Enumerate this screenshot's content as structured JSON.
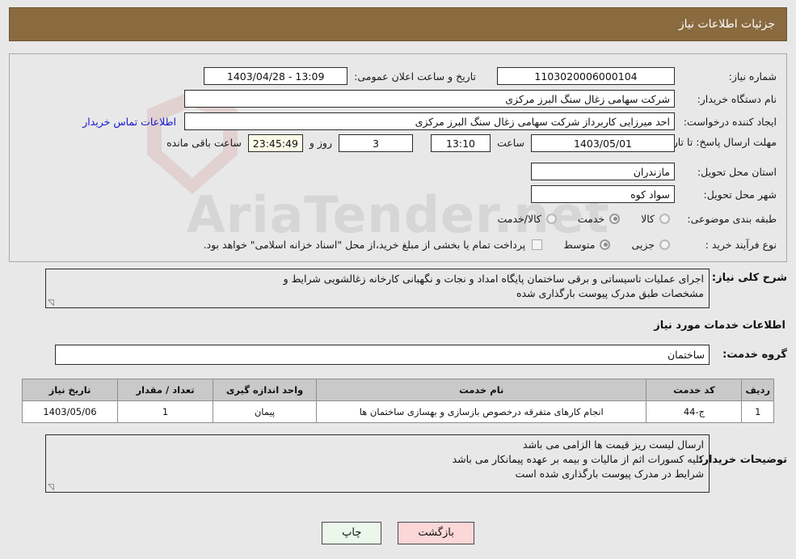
{
  "header": {
    "title": "جزئیات اطلاعات نیاز"
  },
  "form": {
    "need_number_label": "شماره نیاز:",
    "need_number_value": "1103020006000104",
    "announce_label": "تاریخ و ساعت اعلان عمومی:",
    "announce_value": "1403/04/28 - 13:09",
    "buyer_org_label": "نام دستگاه خریدار:",
    "buyer_org_value": "شرکت سهامی زغال سنگ البرز مرکزی",
    "creator_label": "ایجاد کننده درخواست:",
    "creator_value": "احد میرزایی کاربرداز شرکت سهامی زغال سنگ البرز مرکزی",
    "contact_link": "اطلاعات تماس خریدار",
    "deadline_label": "مهلت ارسال پاسخ: تا تاریخ:",
    "deadline_date": "1403/05/01",
    "hour_label": "ساعت",
    "deadline_time": "13:10",
    "days_value": "3",
    "days_label": "روز و",
    "remaining_time": "23:45:49",
    "remaining_label": "ساعت باقی مانده",
    "province_label": "استان محل تحویل:",
    "province_value": "مازندران",
    "city_label": "شهر محل تحویل:",
    "city_value": "سواد کوه",
    "category_label": "طبقه بندی موضوعی:",
    "category_options": [
      "کالا",
      "خدمت",
      "کالا/خدمت"
    ],
    "category_selected": "خدمت",
    "process_label": "نوع فرآیند خرید :",
    "process_options": [
      "جزیی",
      "متوسط"
    ],
    "process_selected": "متوسط",
    "treasury_checkbox_label": "پرداخت تمام یا بخشی از مبلغ خرید،از محل \"اسناد خزانه اسلامی\" خواهد بود.",
    "treasury_checked": false
  },
  "description": {
    "label": "شرح کلی نیاز:",
    "line1": "اجرای عملیات تاسیساتی و برقی ساختمان پایگاه امداد و نجات و نگهبانی کارخانه زغالشویی شرایط و",
    "line2": "مشخصات طبق مدرک پیوست بارگذاری شده"
  },
  "services_section": {
    "heading": "اطلاعات خدمات مورد نیاز",
    "group_label": "گروه خدمت:",
    "group_value": "ساختمان"
  },
  "table": {
    "columns": [
      "ردیف",
      "کد خدمت",
      "نام خدمت",
      "واحد اندازه گیری",
      "تعداد / مقدار",
      "تاریخ نیاز"
    ],
    "rows": [
      {
        "index": "1",
        "code": "ج-44",
        "name": "انجام کارهای متفرقه درخصوص بازسازی و بهسازی ساختمان ها",
        "unit": "پیمان",
        "quantity": "1",
        "need_date": "1403/05/06"
      }
    ]
  },
  "buyer_notes": {
    "label": "توضیحات خریدار:",
    "line1": "ارسال لیست ریز قیمت ها الزامی می باشد",
    "line2": "کلیه کسورات اثم از مالیات و بیمه بر عهده پیمانکار می باشد",
    "line3": "شرایط در مدرک پیوست بارگذاری شده است"
  },
  "footer": {
    "print_label": "چاپ",
    "back_label": "بازگشت"
  },
  "watermark": {
    "text": "AriaTender.net"
  },
  "colors": {
    "header_bg": "#8a6a3f",
    "page_bg": "#e8e8e8",
    "link": "#1414d2",
    "timer_bg": "#fbfbe8",
    "print_btn": "#eaf7ea",
    "back_btn": "#fbd7d7"
  }
}
